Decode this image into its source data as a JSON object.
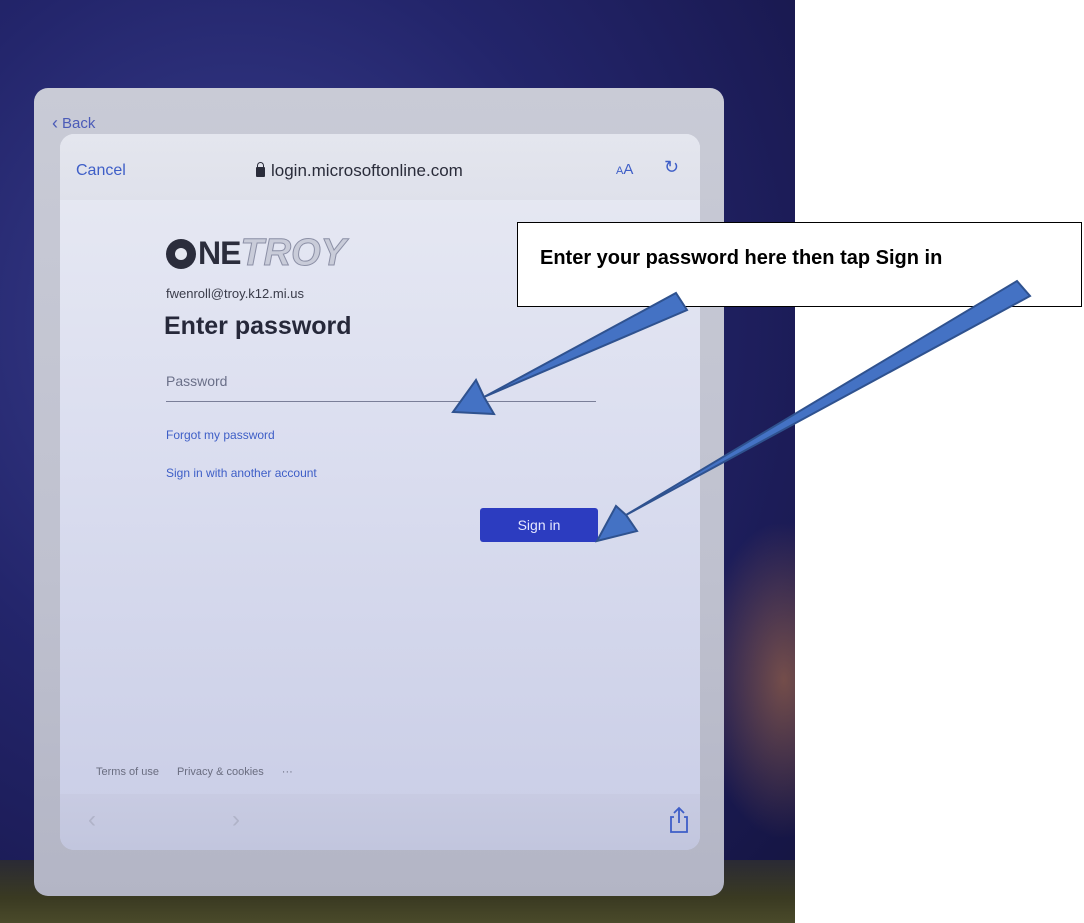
{
  "photo_frame": {
    "back_label": "Back"
  },
  "browser": {
    "cancel_label": "Cancel",
    "url": "login.microsoftonline.com",
    "text_size_label_small": "A",
    "text_size_label_large": "A",
    "lock_icon": "lock-icon",
    "reload_icon": "reload-icon",
    "nav_back_icon": "chevron-left-icon",
    "nav_forward_icon": "chevron-right-icon",
    "share_icon": "share-icon"
  },
  "login": {
    "logo_prefix": "NE",
    "logo_word": "TROY",
    "email": "fwenroll@troy.k12.mi.us",
    "heading": "Enter password",
    "password_placeholder": "Password",
    "password_value": "",
    "forgot_link": "Forgot my password",
    "another_account_link": "Sign in with another account",
    "sign_in_button": "Sign in"
  },
  "footer": {
    "terms": "Terms of use",
    "privacy": "Privacy & cookies",
    "more": "···"
  },
  "annotation": {
    "callout_text": "Enter your password here then tap Sign in",
    "arrow_color": "#4472c4",
    "callout_border_color": "#000000"
  }
}
